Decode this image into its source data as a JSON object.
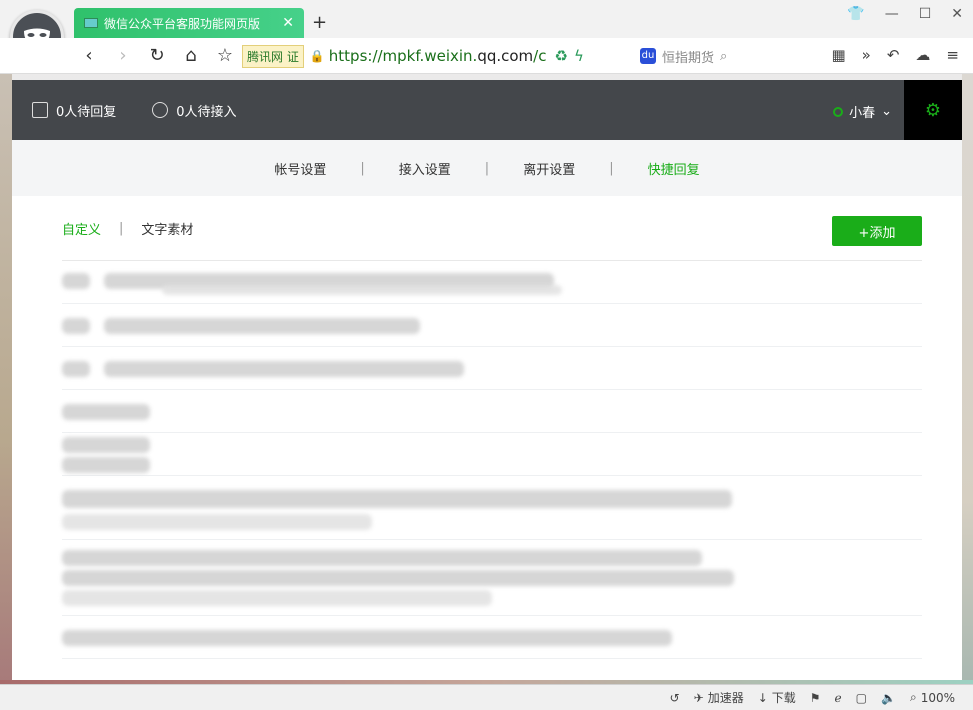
{
  "browser": {
    "tab_title": "微信公众平台客服功能网页版",
    "tab_close": "✕",
    "new_tab": "+",
    "site_badge": "腾讯网 证",
    "url_prefix": "https://mpkf.weixin.",
    "url_domain": "qq.com",
    "url_suffix": "/c",
    "search_placeholder": "恒指期货",
    "more": "»"
  },
  "header": {
    "pending_reply": "0人待回复",
    "pending_accept": "0人待接入",
    "user_name": "小春",
    "status_color": "#1aad19"
  },
  "menu": {
    "items": [
      "帐号设置",
      "接入设置",
      "离开设置",
      "快捷回复"
    ],
    "active_index": 3,
    "separator": "|"
  },
  "subnav": {
    "custom": "自定义",
    "separator": "|",
    "text_material": "文字素材",
    "add_button": "+添加"
  },
  "statusbar": {
    "accelerator": "加速器",
    "download": "下载",
    "zoom": "100%"
  },
  "colors": {
    "accent": "#1aad19",
    "topbar": "#44474b",
    "tab": "#2fc16b"
  }
}
